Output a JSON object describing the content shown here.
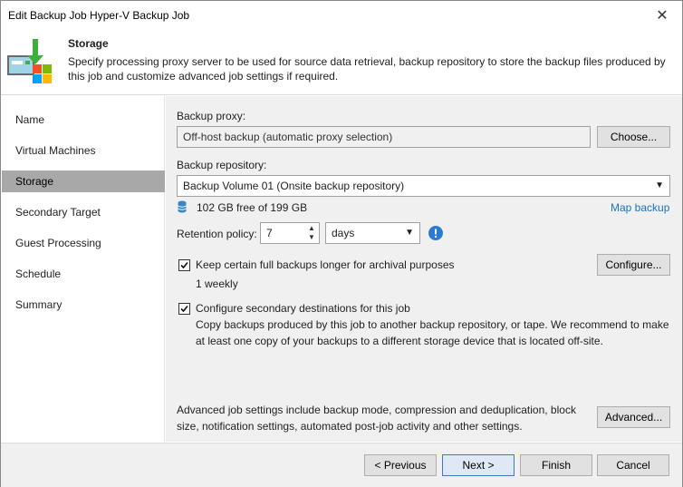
{
  "window": {
    "title": "Edit Backup Job Hyper-V Backup Job",
    "close_glyph": "✕"
  },
  "header": {
    "title": "Storage",
    "description": "Specify processing proxy server to be used for source data retrieval, backup repository to store the backup files produced by this job and customize advanced job settings if required."
  },
  "sidebar": {
    "items": [
      {
        "label": "Name"
      },
      {
        "label": "Virtual Machines"
      },
      {
        "label": "Storage"
      },
      {
        "label": "Secondary Target"
      },
      {
        "label": "Guest Processing"
      },
      {
        "label": "Schedule"
      },
      {
        "label": "Summary"
      }
    ],
    "active_index": 2
  },
  "proxy": {
    "label": "Backup proxy:",
    "value": "Off-host backup (automatic proxy selection)",
    "choose_label": "Choose..."
  },
  "repository": {
    "label": "Backup repository:",
    "value": "Backup Volume 01 (Onsite backup repository)",
    "free_space": "102 GB free of 199 GB",
    "map_backup_label": "Map backup"
  },
  "retention": {
    "label": "Retention policy:",
    "value": "7",
    "unit": "days"
  },
  "archival": {
    "checked": true,
    "label": "Keep certain full backups longer for archival purposes",
    "detail": "1 weekly",
    "configure_label": "Configure..."
  },
  "secondary": {
    "checked": true,
    "label": "Configure secondary destinations for this job",
    "description": "Copy backups produced by this job to another backup repository, or tape. We recommend to make at least one copy of your backups to a different storage device that is located off-site."
  },
  "advanced": {
    "description": "Advanced job settings include backup mode, compression and deduplication, block size, notification settings, automated post-job activity and other settings.",
    "button_label": "Advanced..."
  },
  "footer": {
    "previous_label": "< Previous",
    "next_label": "Next >",
    "finish_label": "Finish",
    "cancel_label": "Cancel"
  },
  "colors": {
    "accent_link": "#1a73c7",
    "info_icon": "#2b7bd0",
    "active_nav": "#a8a8a8"
  },
  "icons": {
    "header_logo": "storage-backup-icon",
    "database": "database-icon",
    "info": "info-icon"
  }
}
